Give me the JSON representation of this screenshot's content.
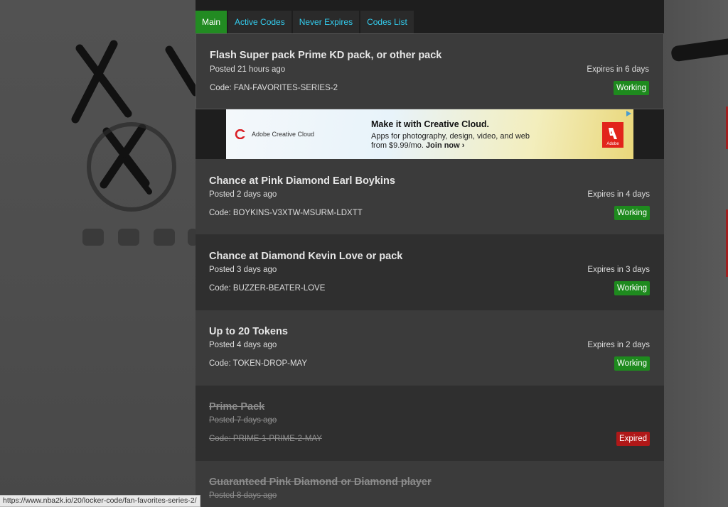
{
  "tabs": [
    {
      "label": "Main",
      "active": true
    },
    {
      "label": "Active Codes",
      "active": false
    },
    {
      "label": "Never Expires",
      "active": false
    },
    {
      "label": "Codes List",
      "active": false
    }
  ],
  "codes": [
    {
      "title": "Flash Super pack Prime KD pack, or other pack",
      "posted": "Posted 21 hours ago",
      "expires": "Expires in 6 days",
      "code": "Code: FAN-FAVORITES-SERIES-2",
      "status": "Working"
    },
    {
      "title": "Chance at Pink Diamond Earl Boykins",
      "posted": "Posted 2 days ago",
      "expires": "Expires in 4 days",
      "code": "Code: BOYKINS-V3XTW-MSURM-LDXTT",
      "status": "Working"
    },
    {
      "title": "Chance at Diamond Kevin Love or pack",
      "posted": "Posted 3 days ago",
      "expires": "Expires in 3 days",
      "code": "Code: BUZZER-BEATER-LOVE",
      "status": "Working"
    },
    {
      "title": "Up to 20 Tokens",
      "posted": "Posted 4 days ago",
      "expires": "Expires in 2 days",
      "code": "Code: TOKEN-DROP-MAY",
      "status": "Working"
    },
    {
      "title": "Prime Pack",
      "posted": "Posted 7 days ago",
      "expires": "",
      "code": "Code: PRIME-1-PRIME-2-MAY",
      "status": "Expired"
    },
    {
      "title": "Guaranteed Pink Diamond or Diamond player",
      "posted": "Posted 8 days ago"
    }
  ],
  "ad": {
    "brand": "Adobe Creative Cloud",
    "headline": "Make it with Creative Cloud.",
    "body": "Apps for photography, design, video, and web from $9.99/mo.",
    "cta": "Join now ›",
    "logo_text": "Adobe"
  },
  "statusbar": {
    "url": "https://www.nba2k.io/20/locker-code/fan-favorites-series-2/"
  },
  "colors": {
    "working": "#1e8a1e",
    "expired": "#b01818",
    "tab_active": "#228b22",
    "tab_link": "#33ccee"
  }
}
